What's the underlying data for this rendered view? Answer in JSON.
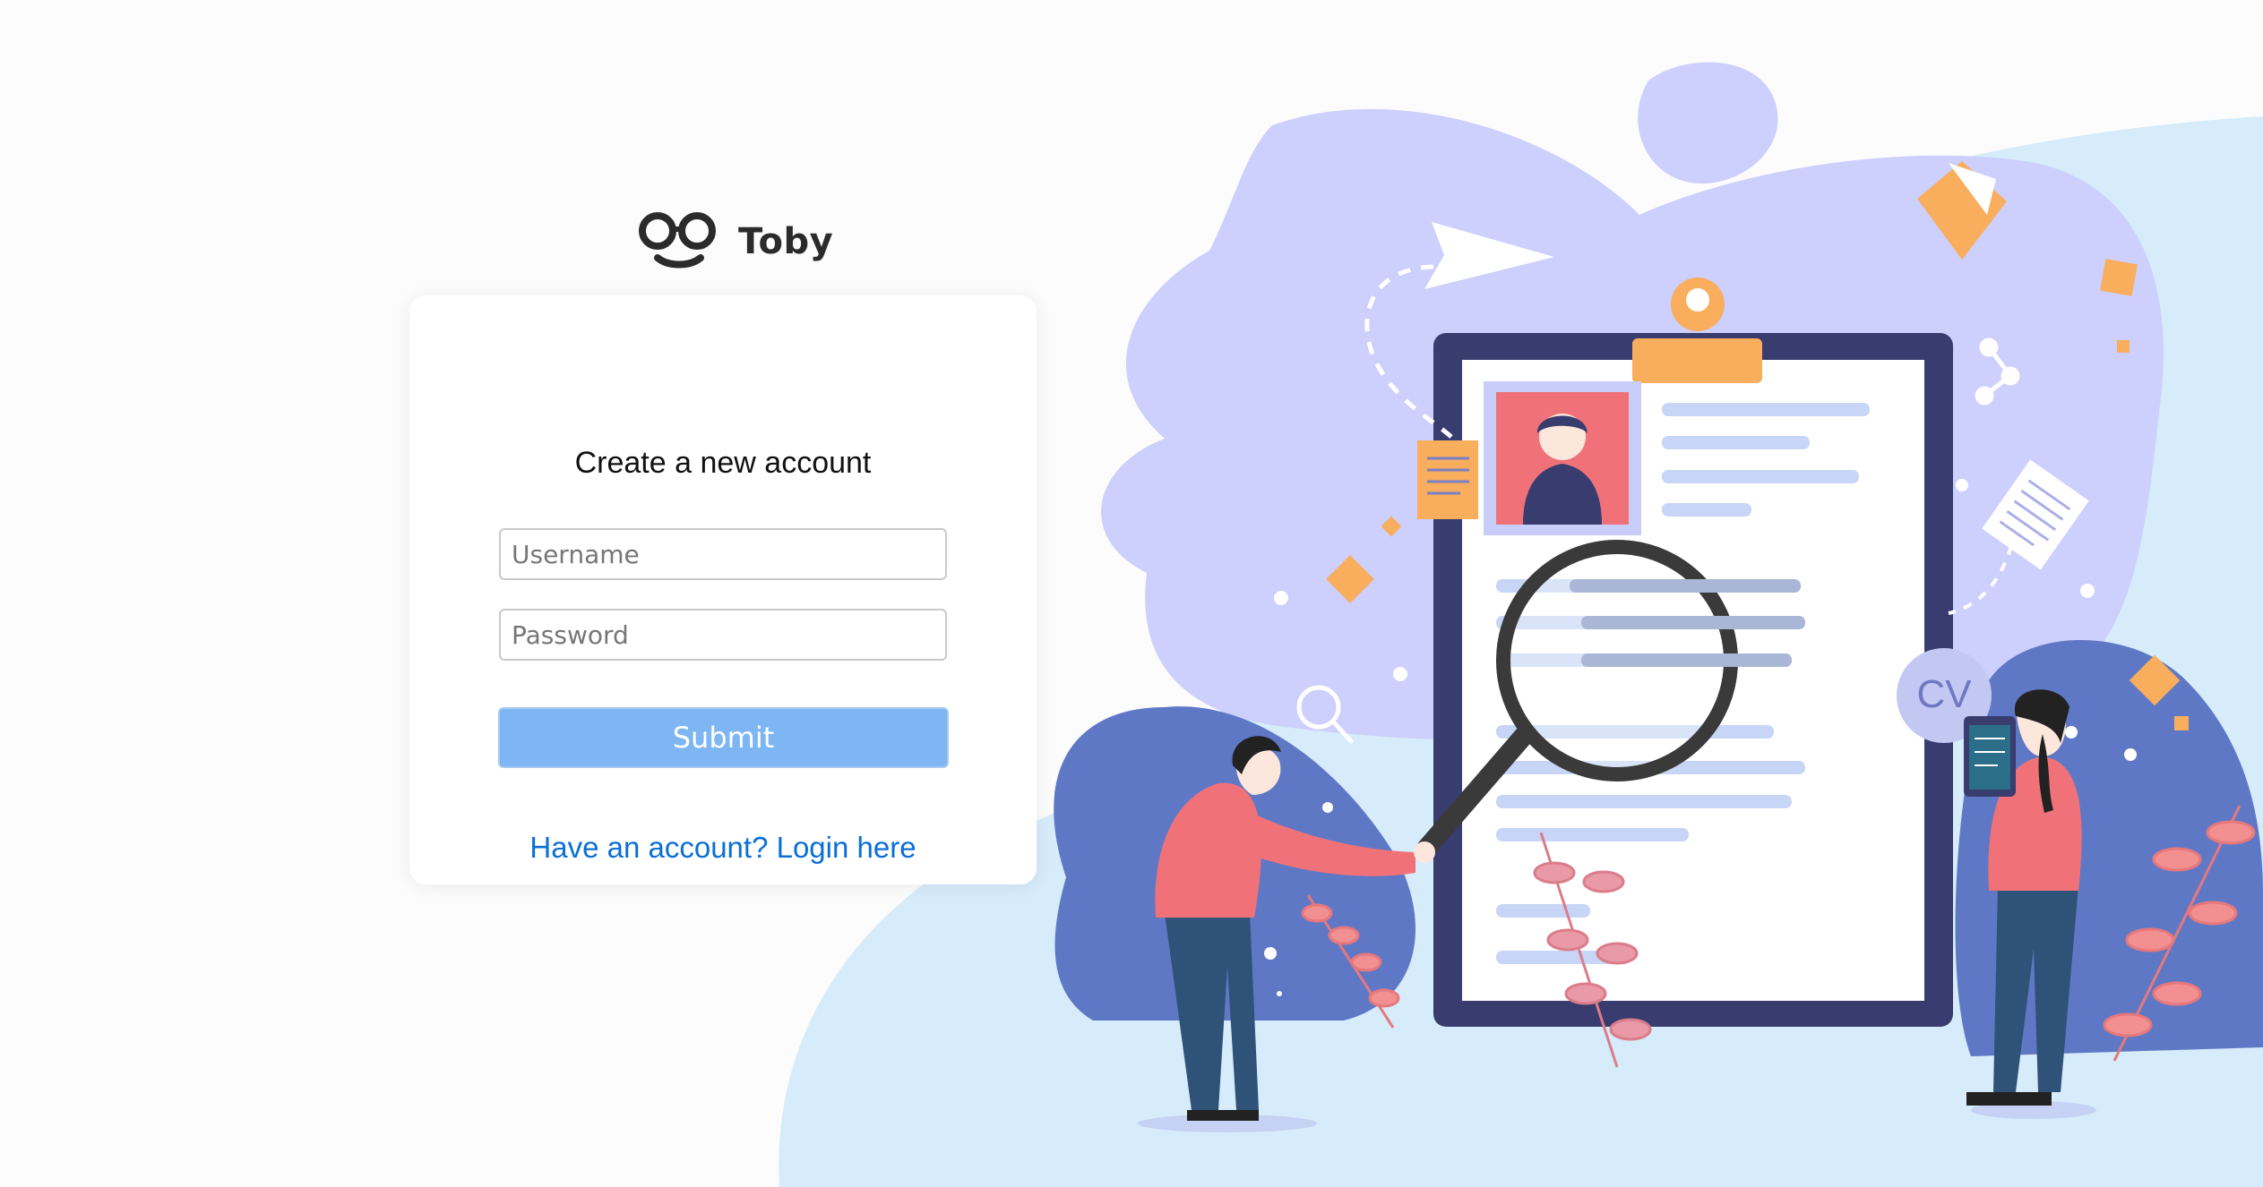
{
  "brand": {
    "name": "Toby",
    "logo_icon": "glasses-smile-icon"
  },
  "form": {
    "title": "Create a new account",
    "username_placeholder": "Username",
    "username_value": "",
    "password_placeholder": "Password",
    "password_value": "",
    "submit_label": "Submit",
    "login_link_label": "Have an account? Login here"
  },
  "illustration": {
    "cv_badge": "CV",
    "subject": "recruitment-cv-review-illustration"
  },
  "colors": {
    "accent_button": "#7eb6f3",
    "link": "#0a6fd6",
    "illustration_lavender": "#cdcffd",
    "illustration_navy": "#383c6e",
    "illustration_blue": "#5f78c6",
    "illustration_coral": "#f07278",
    "illustration_orange": "#f8ae5c",
    "illustration_sky": "#d6ecfa"
  }
}
